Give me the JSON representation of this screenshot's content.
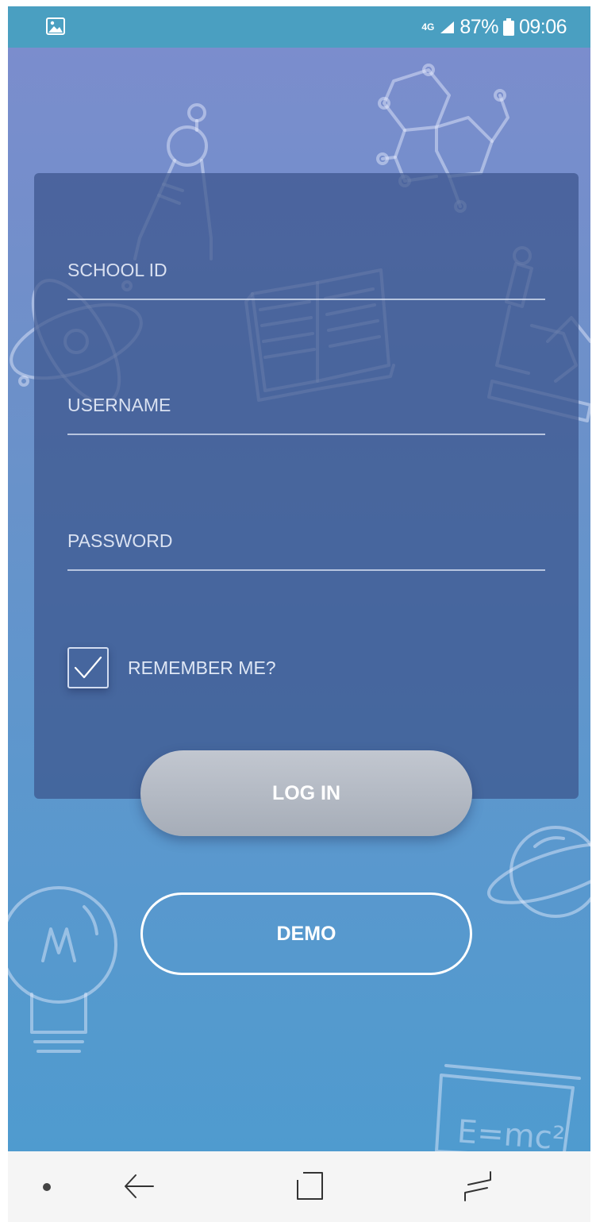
{
  "status_bar": {
    "network": "4G",
    "battery_percent": "87%",
    "time": "09:06",
    "icons": [
      "image-notification-icon",
      "signal-icon",
      "battery-icon"
    ]
  },
  "login_form": {
    "school_id_placeholder": "SCHOOL ID",
    "school_id_value": "",
    "username_placeholder": "USERNAME",
    "username_value": "",
    "password_placeholder": "PASSWORD",
    "password_value": "",
    "remember_label": "REMEMBER ME?",
    "remember_checked": true
  },
  "buttons": {
    "login_label": "LOG IN",
    "demo_label": "DEMO"
  },
  "background_doodles": {
    "formula_text": "E=mc²",
    "icons": [
      "molecule-icon",
      "compass-icon",
      "atom-icon",
      "book-icon",
      "microscope-icon",
      "planet-icon",
      "lightbulb-icon",
      "chalkboard-icon"
    ]
  },
  "navigation_bar": {
    "icons": [
      "dot-icon",
      "back-icon",
      "home-icon",
      "recent-apps-icon"
    ]
  },
  "colors": {
    "status_bar": "#4a9fc1",
    "gradient_top": "#7b8dcd",
    "gradient_bottom": "#4f9bcf",
    "card": "#3c548c",
    "login_button": "#b3b9c4",
    "nav_bar": "#f5f5f5"
  }
}
